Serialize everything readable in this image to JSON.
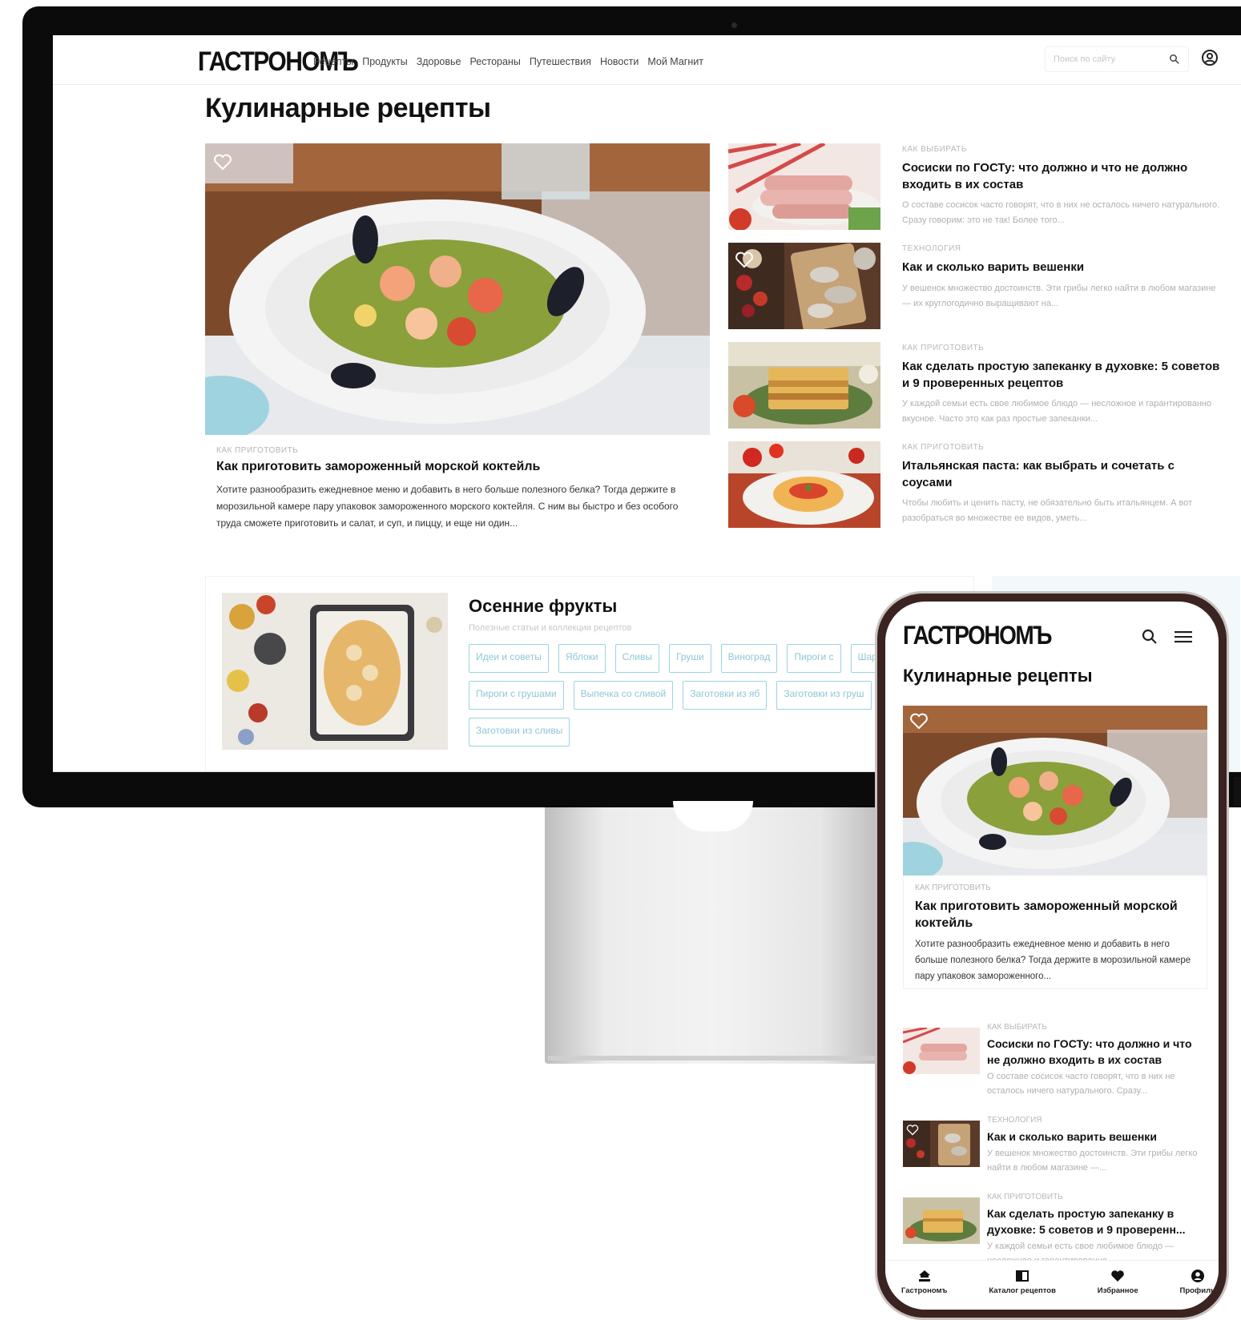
{
  "site": {
    "logo": "ГАСТРОНОМЪ",
    "nav": [
      "Рецепты",
      "Продукты",
      "Здоровье",
      "Рестораны",
      "Путешествия",
      "Новости",
      "Мой Магнит"
    ],
    "search_placeholder": "Поиск по сайту"
  },
  "page_title": "Кулинарные рецепты",
  "hero": {
    "category": "КАК ПРИГОТОВИТЬ",
    "title": "Как приготовить замороженный морской коктейль",
    "description": "Хотите разнообразить ежедневное меню и добавить в него больше полезного белка? Тогда держите в морозильной камере пару упаковок замороженного морского коктейля. С ним вы быстро и без особого труда сможете приготовить и салат, и суп, и пиццу, и еще ни один..."
  },
  "articles": [
    {
      "category": "КАК ВЫБИРАТЬ",
      "title": "Сосиски по ГОСТу: что должно и что не должно входить в их состав",
      "description": "О составе сосисок часто говорят, что в них не осталось ничего натурального. Сразу говорим: это не так! Более того..."
    },
    {
      "category": "ТЕХНОЛОГИЯ",
      "title": "Как и сколько варить вешенки",
      "description": "У вешенок множество достоинств. Эти грибы легко найти в любом магазине — их круглогодично выращивают на..."
    },
    {
      "category": "КАК ПРИГОТОВИТЬ",
      "title": "Как сделать простую запеканку в духовке: 5 советов и 9 проверенных рецептов",
      "description": "У каждой семьи есть свое любимое блюдо — несложное и гарантированно вкусное. Часто это как раз простые запеканки..."
    },
    {
      "category": "КАК ПРИГОТОВИТЬ",
      "title": "Итальянская паста: как выбрать и сочетать с соусами",
      "description": "Чтобы любить и ценить пасту, не обязательно быть итальянцем. А вот разобраться во множестве ее видов, уметь..."
    }
  ],
  "autumn": {
    "title": "Осенние фрукты",
    "subtitle": "Полезные статьи и коллекции рецептов",
    "tags": [
      "Идеи и советы",
      "Яблоки",
      "Сливы",
      "Груши",
      "Виноград",
      "Пироги с",
      "Шарлотка",
      "Пироги с грушами",
      "Выпечка со сливой",
      "Заготовки из яб",
      "Заготовки из груш",
      "Заготовки из сливы"
    ]
  },
  "mobile": {
    "logo": "ГАСТРОНОМЪ",
    "page_title": "Кулинарные рецепты",
    "hero": {
      "category": "КАК ПРИГОТОВИТЬ",
      "title": "Как приготовить замороженный морской коктейль",
      "description": "Хотите разнообразить ежедневное меню и добавить в него больше полезного белка? Тогда держите в морозильной камере пару упаковок замороженного..."
    },
    "articles": [
      {
        "category": "КАК ВЫБИРАТЬ",
        "title": "Сосиски по ГОСТу: что должно и что не должно входить в их состав",
        "description": "О составе сосисок часто говорят, что в них не осталось ничего натурального. Сразу..."
      },
      {
        "category": "ТЕХНОЛОГИЯ",
        "title": "Как и сколько варить вешенки",
        "description": "У вешенок множество достоинств. Эти грибы легко найти в любом магазине —..."
      },
      {
        "category": "КАК ПРИГОТОВИТЬ",
        "title": "Как сделать простую запеканку в духовке: 5 советов и 9 проверенн...",
        "description": "У каждой семьи есть свое любимое блюдо — несложное и гарантированно"
      }
    ],
    "tabbar": [
      "Гастрономъ",
      "Каталог рецептов",
      "Избранное",
      "Профиль"
    ]
  },
  "colors": {
    "accent_tag": "#8ec7d6",
    "phone_frame": "#3a2320",
    "promo_bg": "#f3f9fb"
  }
}
